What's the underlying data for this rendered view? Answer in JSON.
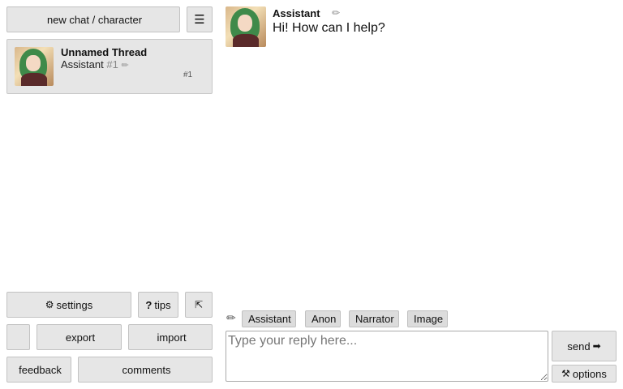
{
  "sidebar": {
    "new_chat": {
      "icon": "",
      "label": "new chat / character"
    },
    "menu_icon": "☰",
    "thread": {
      "title": "Unnamed Thread",
      "character": "Assistant",
      "number": "#1",
      "edit_icon": "✏",
      "icon_top": "",
      "icon_middle": "",
      "icon_bottom": "",
      "count_icon": "",
      "count": "#1"
    },
    "bottom": {
      "settings": {
        "icon": "⚙",
        "label": "settings"
      },
      "tips": {
        "icon": "?",
        "label": "tips"
      },
      "collapse_icon": "⇱",
      "lock_icon": "",
      "export": {
        "icon": "",
        "label": "export"
      },
      "import": {
        "icon": "",
        "label": "import"
      },
      "feedback": {
        "icon": "",
        "label": "feedback"
      },
      "comments": {
        "icon": "",
        "label": "comments"
      }
    }
  },
  "chat": {
    "messages": [
      {
        "name": "Assistant",
        "edit_icon": "✏",
        "icon_a": "",
        "icon_b": "",
        "text": "Hi! How can I help?"
      }
    ],
    "compose": {
      "pencil_icon": "✏",
      "roles": [
        {
          "icon": "",
          "label": "Assistant"
        },
        {
          "icon": "",
          "label": "Anon"
        },
        {
          "icon": "",
          "label": "Narrator"
        },
        {
          "icon": "",
          "label": "Image"
        }
      ],
      "reply_value": "",
      "reply_placeholder": "Type your reply here...",
      "send": {
        "label": "send",
        "icon": "➡"
      },
      "options": {
        "icon": "⚒",
        "label": "options"
      }
    }
  }
}
